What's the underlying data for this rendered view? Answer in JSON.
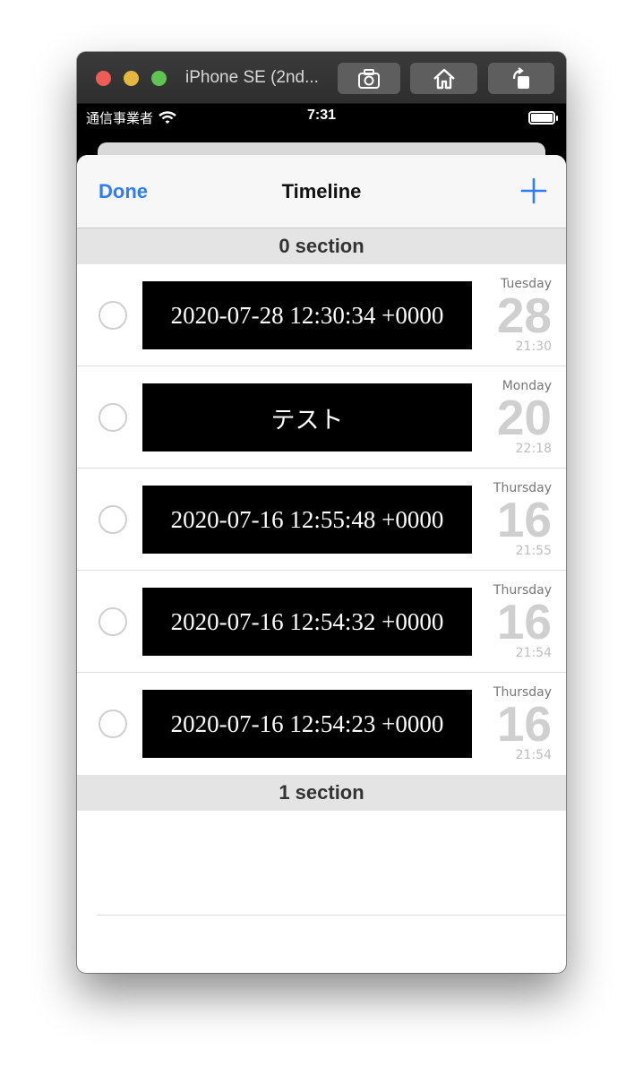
{
  "window": {
    "title": "iPhone SE (2nd...",
    "screenshot_icon": "camera-icon",
    "home_icon": "home-icon",
    "rotate_icon": "rotate-icon"
  },
  "status_bar": {
    "carrier": "通信事業者",
    "time": "7:31"
  },
  "nav": {
    "done": "Done",
    "title": "Timeline",
    "add_icon": "plus-icon",
    "accent_color": "#2f7cf6"
  },
  "sections": [
    {
      "header": "0 section"
    },
    {
      "header": "1 section"
    }
  ],
  "rows": [
    {
      "text": "2020-07-28 12:30:34 +0000",
      "weekday": "Tuesday",
      "day": "28",
      "time": "21:30"
    },
    {
      "text": "テスト",
      "weekday": "Monday",
      "day": "20",
      "time": "22:18"
    },
    {
      "text": "2020-07-16 12:55:48 +0000",
      "weekday": "Thursday",
      "day": "16",
      "time": "21:55"
    },
    {
      "text": "2020-07-16 12:54:32 +0000",
      "weekday": "Thursday",
      "day": "16",
      "time": "21:54"
    },
    {
      "text": "2020-07-16 12:54:23 +0000",
      "weekday": "Thursday",
      "day": "16",
      "time": "21:54"
    }
  ]
}
